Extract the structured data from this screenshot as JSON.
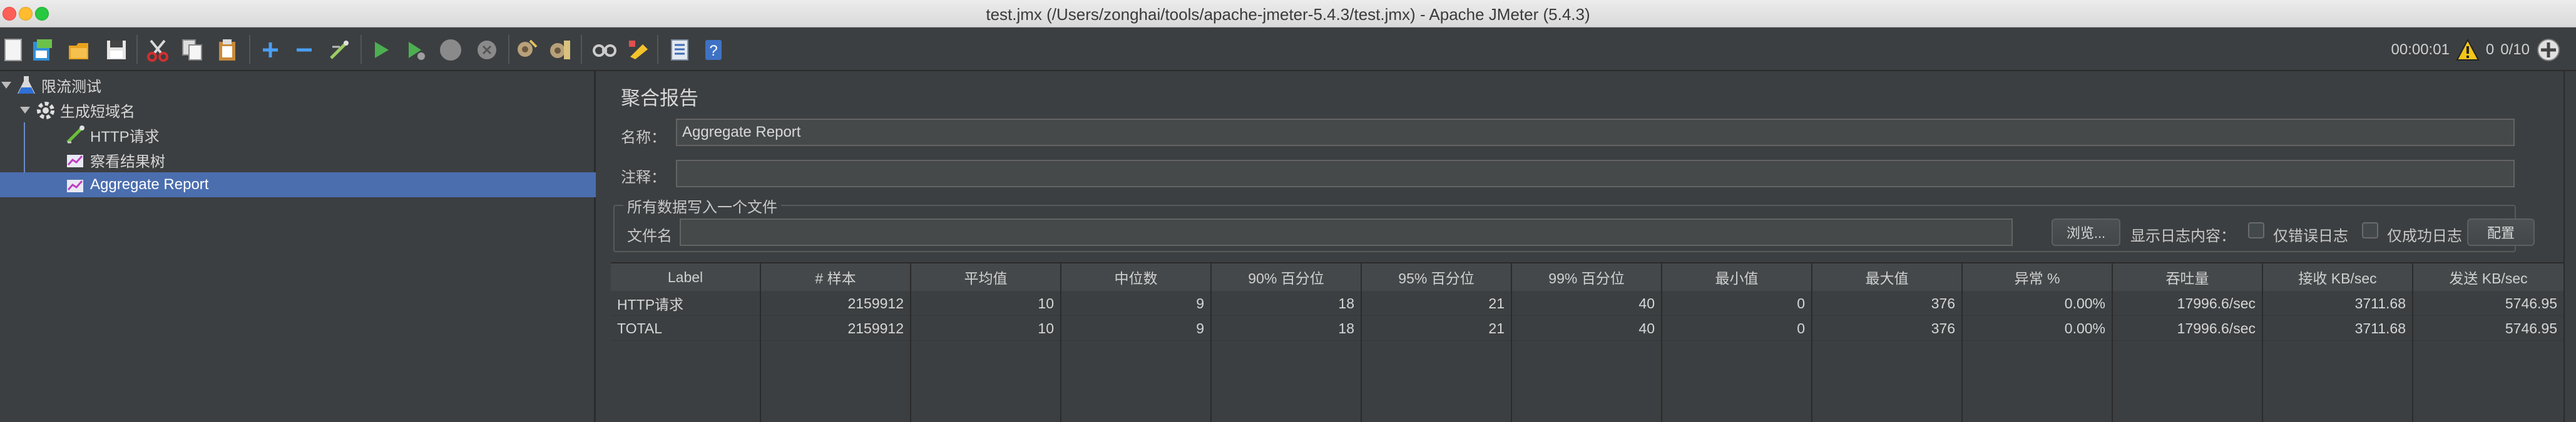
{
  "window": {
    "title": "test.jmx (/Users/zonghai/tools/apache-jmeter-5.4.3/test.jmx) - Apache JMeter (5.4.3)"
  },
  "toolbar": {
    "buttons": [
      "new-icon",
      "templates-icon",
      "open-icon",
      "save-icon",
      "cut-icon",
      "copy-icon",
      "paste-icon",
      "expand-icon",
      "collapse-icon",
      "toggle-icon",
      "start-icon",
      "start-no-pause-icon",
      "stop-icon",
      "shutdown-icon",
      "clear-icon",
      "clear-all-icon",
      "search-icon",
      "reset-search-icon",
      "function-helper-icon",
      "help-icon"
    ],
    "elapsed": "00:00:01",
    "warnings": "0",
    "threads": "0/10"
  },
  "tree": {
    "items": [
      {
        "label": "限流测试",
        "icon": "test-plan-icon"
      },
      {
        "label": "生成短域名",
        "icon": "thread-group-icon"
      },
      {
        "label": "HTTP请求",
        "icon": "http-sampler-icon"
      },
      {
        "label": "察看结果树",
        "icon": "listener-icon"
      },
      {
        "label": "Aggregate Report",
        "icon": "listener-icon"
      }
    ]
  },
  "panel": {
    "title": "聚合报告",
    "name_label": "名称：",
    "name_value": "Aggregate Report",
    "comment_label": "注释：",
    "comment_value": "",
    "file_group_title": "所有数据写入一个文件",
    "file_label": "文件名",
    "file_value": "",
    "browse_label": "浏览...",
    "log_content_label": "显示日志内容：",
    "errors_only_label": "仅错误日志",
    "success_only_label": "仅成功日志",
    "configure_label": "配置"
  },
  "table": {
    "columns": [
      "Label",
      "# 样本",
      "平均值",
      "中位数",
      "90% 百分位",
      "95% 百分位",
      "99% 百分位",
      "最小值",
      "最大值",
      "异常 %",
      "吞吐量",
      "接收 KB/sec",
      "发送 KB/sec"
    ],
    "rows": [
      [
        "HTTP请求",
        "2159912",
        "10",
        "9",
        "18",
        "21",
        "40",
        "0",
        "376",
        "0.00%",
        "17996.6/sec",
        "3711.68",
        "5746.95"
      ],
      [
        "TOTAL",
        "2159912",
        "10",
        "9",
        "18",
        "21",
        "40",
        "0",
        "376",
        "0.00%",
        "17996.6/sec",
        "3711.68",
        "5746.95"
      ]
    ]
  },
  "colors": {
    "background": "#3c3f41",
    "selection": "#4b6eaf",
    "start_green": "#4caf50"
  }
}
